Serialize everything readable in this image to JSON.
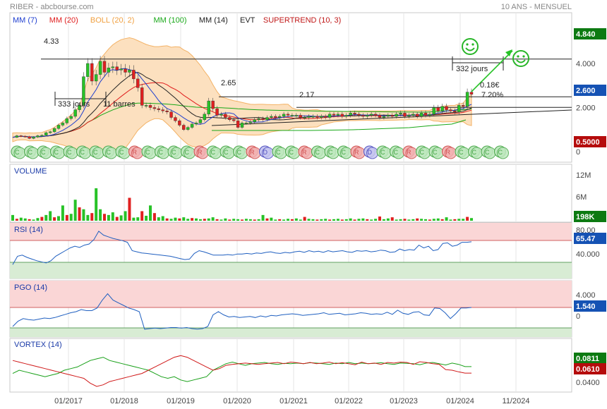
{
  "header": {
    "title": "RIBER - abcbourse.com",
    "period": "10 ANS - MENSUEL"
  },
  "legend": [
    {
      "label": "MM (7)",
      "color": "#1f3fd0"
    },
    {
      "label": "MM (20)",
      "color": "#e01e1e"
    },
    {
      "label": "BOLL (20, 2)",
      "color": "#f0a040"
    },
    {
      "label": "MM (100)",
      "color": "#18a818"
    },
    {
      "label": "MM (14)",
      "color": "#222222"
    },
    {
      "label": "EVT",
      "color": "#222222"
    },
    {
      "label": "SUPERTREND (10, 3)",
      "color": "#c01818"
    }
  ],
  "annotations": {
    "level_high": "4.33",
    "level_mid": "2.65",
    "level_low": "2.17",
    "span_left": "333 jours",
    "span_left_bars": "11 barres",
    "span_right": "332 jours",
    "target_price": "0.18€",
    "target_pct": "7.20%"
  },
  "panels": {
    "volume": "VOLUME",
    "rsi": "RSI (14)",
    "pgo": "PGO (14)",
    "vortex": "VORTEX (14)"
  },
  "badges": {
    "price_top": "4.840",
    "price_last": "2.600",
    "supertrend": "0.5000",
    "volume": "198K",
    "rsi": "65.47",
    "pgo": "1.540",
    "vortex_plus": "0.0811",
    "vortex_minus": "0.0610"
  },
  "colors": {
    "badge_green": "#0d7a12",
    "badge_blue": "#1552b4",
    "badge_red": "#b50c0c",
    "band_fill": "#fce0bf",
    "zone_red": "#fad6d6",
    "zone_green": "#d8ecd4",
    "candle_up": "#27c227",
    "candle_down": "#e02020"
  },
  "chart_data": {
    "type": "candlestick",
    "x_ticks": [
      "01/2017",
      "01/2018",
      "01/2019",
      "01/2020",
      "01/2021",
      "01/2022",
      "01/2023",
      "01/2024",
      "11/2024"
    ],
    "price_axis": {
      "ticks": [
        "4.000",
        "2.000",
        "0"
      ],
      "range": [
        0,
        5.6
      ]
    },
    "price_close_monthly": [
      0.65,
      0.72,
      0.7,
      0.68,
      0.6,
      0.66,
      0.72,
      0.74,
      0.86,
      0.9,
      1.05,
      1.2,
      1.3,
      1.5,
      1.6,
      1.9,
      2.1,
      3.4,
      4.0,
      3.2,
      3.5,
      4.1,
      3.6,
      3.8,
      3.85,
      3.7,
      3.75,
      3.6,
      3.7,
      3.3,
      2.9,
      2.1,
      2.1,
      2.0,
      1.95,
      1.9,
      1.85,
      1.8,
      1.55,
      1.4,
      1.2,
      1.0,
      1.1,
      1.25,
      1.3,
      1.45,
      1.7,
      2.3,
      1.95,
      1.65,
      1.7,
      1.55,
      1.45,
      1.4,
      1.1,
      1.3,
      1.3,
      1.35,
      1.45,
      1.5,
      1.45,
      1.55,
      1.6,
      1.55,
      1.6,
      1.7,
      1.65,
      1.65,
      1.65,
      1.55,
      1.55,
      1.6,
      1.6,
      1.55,
      1.6,
      1.55,
      1.7,
      1.65,
      1.7,
      1.6,
      1.65,
      1.75,
      1.7,
      1.65,
      1.6,
      1.65,
      1.7,
      1.65,
      1.55,
      1.6,
      1.65,
      1.6,
      1.7,
      1.75,
      1.6,
      1.65,
      1.7,
      1.6,
      1.75,
      1.65,
      1.7,
      2.0,
      1.85,
      2.05,
      1.9,
      1.85,
      1.8,
      2.1,
      2.05,
      2.7,
      2.6
    ],
    "volume_axis": {
      "ticks": [
        "12M",
        "6M"
      ]
    },
    "volume_monthly_m": [
      1.5,
      0.5,
      0.8,
      0.6,
      0.4,
      0.3,
      0.7,
      1.0,
      1.5,
      2.5,
      0.9,
      1.2,
      4.0,
      1.5,
      1.8,
      5.5,
      3.5,
      3.0,
      1.5,
      2.0,
      8.5,
      3.0,
      1.8,
      1.5,
      2.2,
      1.0,
      1.4,
      2.5,
      6.0,
      0.8,
      0.9,
      2.5,
      1.3,
      4.0,
      2.0,
      0.9,
      1.2,
      0.6,
      0.5,
      0.8,
      0.6,
      0.9,
      0.5,
      0.7,
      0.6,
      0.4,
      0.5,
      0.6,
      0.9,
      0.4,
      0.3,
      0.6,
      0.3,
      0.5,
      0.4,
      0.3,
      0.5,
      0.4,
      0.3,
      0.4,
      1.5,
      0.6,
      0.8,
      0.3,
      0.4,
      0.3,
      0.5,
      0.4,
      0.6,
      0.3,
      1.0,
      0.5,
      0.4,
      0.3,
      0.4,
      0.5,
      0.3,
      0.4,
      0.5,
      0.3,
      0.4,
      0.6,
      0.3,
      0.5,
      0.6,
      0.4,
      0.3,
      0.5,
      1.1,
      0.4,
      0.6,
      0.9,
      0.3,
      0.4,
      0.5,
      0.3,
      0.4,
      0.6,
      0.5,
      0.4,
      0.3,
      0.5,
      0.6,
      0.4,
      0.9,
      0.3,
      0.4,
      0.5,
      0.5,
      1.0,
      0.7
    ],
    "rsi_axis": {
      "ticks": [
        "80.00",
        "40.000"
      ]
    },
    "rsi_monthly": [
      25,
      40,
      42,
      38,
      35,
      32,
      30,
      28,
      32,
      40,
      45,
      50,
      55,
      58,
      56,
      60,
      62,
      70,
      85,
      78,
      75,
      72,
      70,
      68,
      65,
      50,
      48,
      46,
      45,
      44,
      43,
      42,
      41,
      40,
      38,
      36,
      34,
      35,
      45,
      50,
      48,
      45,
      42,
      42,
      42,
      43,
      42,
      44,
      44,
      45,
      44,
      46,
      45,
      47,
      48,
      46,
      45,
      47,
      46,
      48,
      49,
      47,
      50,
      48,
      49,
      47,
      50,
      48,
      49,
      50,
      48,
      47,
      50,
      49,
      50,
      48,
      49,
      51,
      50,
      47,
      48,
      53,
      50,
      52,
      51,
      60,
      55,
      58,
      50,
      52,
      63,
      64,
      58,
      60,
      65,
      65,
      66
    ],
    "pgo_axis": {
      "ticks": [
        "4.000",
        "0"
      ]
    },
    "pgo_monthly": [
      -2.0,
      -1.0,
      -0.5,
      -0.7,
      -0.8,
      -0.6,
      -0.4,
      -0.5,
      -0.3,
      0.0,
      0.3,
      0.6,
      0.8,
      1.2,
      1.0,
      1.0,
      1.5,
      3.0,
      4.2,
      3.0,
      2.5,
      2.0,
      1.5,
      1.2,
      0.8,
      -2.5,
      -2.4,
      -2.3,
      -2.4,
      -2.3,
      -2.2,
      -2.2,
      -2.3,
      -2.2,
      -2.4,
      -2.5,
      -2.4,
      -2.0,
      0.2,
      0.8,
      0.2,
      -0.2,
      -0.1,
      -0.3,
      -0.2,
      -0.1,
      -0.3,
      0.0,
      -0.2,
      0.1,
      0.0,
      0.2,
      0.3,
      0.4,
      0.3,
      0.1,
      0.2,
      0.3,
      0.4,
      0.6,
      0.3,
      0.4,
      0.5,
      0.2,
      0.3,
      0.4,
      0.6,
      0.5,
      0.3,
      0.4,
      0.3,
      0.7,
      0.3,
      1.1,
      0.5,
      0.3,
      0.7,
      0.8,
      0.2,
      0.1,
      1.5,
      1.4,
      0.6,
      -0.5,
      0.4,
      1.5,
      1.5,
      1.6
    ],
    "vortex_axis": {
      "ticks": [
        "0.0400"
      ]
    },
    "vortex_plus_monthly": [
      0.06,
      0.07,
      0.065,
      0.06,
      0.055,
      0.05,
      0.055,
      0.06,
      0.07,
      0.075,
      0.08,
      0.09,
      0.1,
      0.105,
      0.11,
      0.1,
      0.095,
      0.09,
      0.085,
      0.08,
      0.075,
      0.07,
      0.06,
      0.05,
      0.045,
      0.05,
      0.04,
      0.035,
      0.04,
      0.045,
      0.05,
      0.07,
      0.08,
      0.09,
      0.095,
      0.09,
      0.085,
      0.09,
      0.092,
      0.094,
      0.09,
      0.088,
      0.091,
      0.09,
      0.092,
      0.09,
      0.093,
      0.092,
      0.09,
      0.088,
      0.092,
      0.09,
      0.094,
      0.09,
      0.092,
      0.09,
      0.091,
      0.093,
      0.09,
      0.088,
      0.092,
      0.091,
      0.09,
      0.087,
      0.092,
      0.094,
      0.09,
      0.086,
      0.092,
      0.088,
      0.081,
      0.0811
    ],
    "vortex_minus_monthly": [
      0.1,
      0.095,
      0.09,
      0.085,
      0.08,
      0.075,
      0.07,
      0.065,
      0.06,
      0.055,
      0.05,
      0.045,
      0.03,
      0.02,
      0.025,
      0.035,
      0.04,
      0.045,
      0.05,
      0.055,
      0.06,
      0.07,
      0.08,
      0.09,
      0.1,
      0.11,
      0.115,
      0.11,
      0.1,
      0.09,
      0.08,
      0.07,
      0.075,
      0.085,
      0.088,
      0.09,
      0.092,
      0.09,
      0.088,
      0.09,
      0.092,
      0.094,
      0.09,
      0.095,
      0.093,
      0.09,
      0.094,
      0.09,
      0.092,
      0.095,
      0.09,
      0.093,
      0.09,
      0.087,
      0.095,
      0.09,
      0.092,
      0.088,
      0.094,
      0.092,
      0.095,
      0.094,
      0.088,
      0.096,
      0.094,
      0.09,
      0.088,
      0.072,
      0.07,
      0.065,
      0.061,
      0.061
    ]
  }
}
